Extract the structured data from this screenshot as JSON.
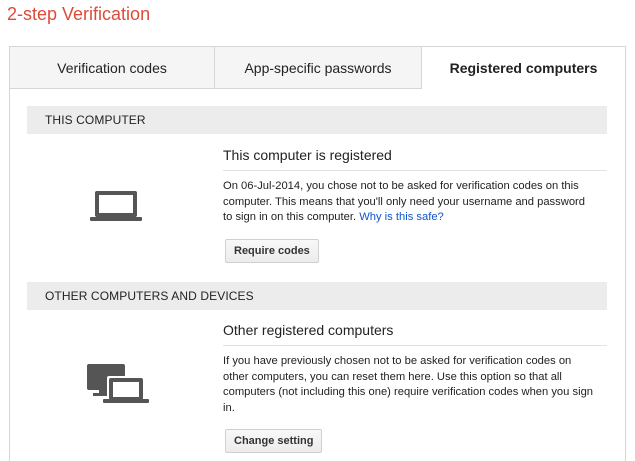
{
  "page": {
    "title": "2-step Verification"
  },
  "tabs": [
    {
      "label": "Verification codes",
      "active": false
    },
    {
      "label": "App-specific passwords",
      "active": false
    },
    {
      "label": "Registered computers",
      "active": true
    }
  ],
  "this_computer": {
    "header": "THIS COMPUTER",
    "icon": "laptop-icon",
    "title": "This computer is registered",
    "text": "On 06-Jul-2014, you chose not to be asked for verification codes on this computer. This means that you'll only need your username and password to sign in on this computer.",
    "link": "Why is this safe?",
    "button": "Require codes"
  },
  "other_computers": {
    "header": "OTHER COMPUTERS AND DEVICES",
    "icon": "multiple-computers-icon",
    "title": "Other registered computers",
    "text": "If you have previously chosen not to be asked for verification codes on other computers, you can reset them here. Use this option so that all computers (not including this one) require verification codes when you sign in.",
    "button": "Change setting"
  },
  "colors": {
    "title": "#dd4b39",
    "link": "#1155cc",
    "section_bg": "#ececec",
    "icon": "#555555"
  }
}
